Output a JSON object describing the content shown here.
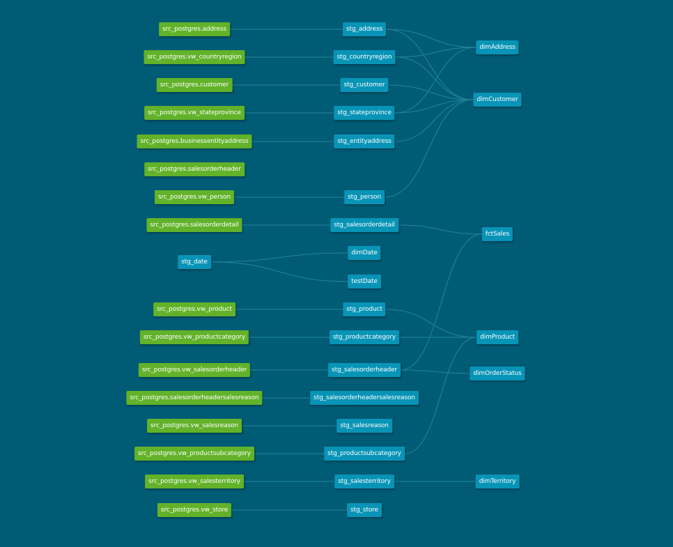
{
  "colors": {
    "background": "#005b75",
    "source_node": "#62b22a",
    "model_node": "#0894b6",
    "edge": "#1e7e92"
  },
  "nodes": [
    {
      "id": "src_address",
      "label": "src_postgres.address",
      "kind": "source"
    },
    {
      "id": "src_countryregion",
      "label": "src_postgres.vw_countryregion",
      "kind": "source"
    },
    {
      "id": "src_customer",
      "label": "src_postgres.customer",
      "kind": "source"
    },
    {
      "id": "src_stateprovince",
      "label": "src_postgres.vw_stateprovince",
      "kind": "source"
    },
    {
      "id": "src_businessentityaddress",
      "label": "src_postgres.businessentityaddress",
      "kind": "source"
    },
    {
      "id": "src_salesorderheader",
      "label": "src_postgres.salesorderheader",
      "kind": "source"
    },
    {
      "id": "src_person",
      "label": "src_postgres.vw_person",
      "kind": "source"
    },
    {
      "id": "src_salesorderdetail",
      "label": "src_postgres.salesorderdetail",
      "kind": "source"
    },
    {
      "id": "stg_date",
      "label": "stg_date",
      "kind": "model"
    },
    {
      "id": "src_product",
      "label": "src_postgres.vw_product",
      "kind": "source"
    },
    {
      "id": "src_productcategory",
      "label": "src_postgres.vw_productcategory",
      "kind": "source"
    },
    {
      "id": "src_vw_salesorderheader",
      "label": "src_postgres.vw_salesorderheader",
      "kind": "source"
    },
    {
      "id": "src_salesorderheadersalesreason",
      "label": "src_postgres.salesorderheadersalesreason",
      "kind": "source"
    },
    {
      "id": "src_salesreason",
      "label": "src_postgres.vw_salesreason",
      "kind": "source"
    },
    {
      "id": "src_productsubcategory",
      "label": "src_postgres.vw_productsubcategory",
      "kind": "source"
    },
    {
      "id": "src_salesterritory",
      "label": "src_postgres.vw_salesterritory",
      "kind": "source"
    },
    {
      "id": "src_store",
      "label": "src_postgres.vw_store",
      "kind": "source"
    },
    {
      "id": "stg_address",
      "label": "stg_address",
      "kind": "model"
    },
    {
      "id": "stg_countryregion",
      "label": "stg_countryregion",
      "kind": "model"
    },
    {
      "id": "stg_customer",
      "label": "stg_customer",
      "kind": "model"
    },
    {
      "id": "stg_stateprovince",
      "label": "stg_stateprovince",
      "kind": "model"
    },
    {
      "id": "stg_entityaddress",
      "label": "stg_entityaddress",
      "kind": "model"
    },
    {
      "id": "stg_person",
      "label": "stg_person",
      "kind": "model"
    },
    {
      "id": "stg_salesorderdetail",
      "label": "stg_salesorderdetail",
      "kind": "model"
    },
    {
      "id": "dimDate",
      "label": "dimDate",
      "kind": "model"
    },
    {
      "id": "testDate",
      "label": "testDate",
      "kind": "model"
    },
    {
      "id": "stg_product",
      "label": "stg_product",
      "kind": "model"
    },
    {
      "id": "stg_productcategory",
      "label": "stg_productcategory",
      "kind": "model"
    },
    {
      "id": "stg_salesorderheader",
      "label": "stg_salesorderheader",
      "kind": "model"
    },
    {
      "id": "stg_salesorderheadersalesreason",
      "label": "stg_salesorderheadersalesreason",
      "kind": "model"
    },
    {
      "id": "stg_salesreason",
      "label": "stg_salesreason",
      "kind": "model"
    },
    {
      "id": "stg_productsubcategory",
      "label": "stg_productsubcategory",
      "kind": "model"
    },
    {
      "id": "stg_salesterritory",
      "label": "stg_salesterritory",
      "kind": "model"
    },
    {
      "id": "stg_store",
      "label": "stg_store",
      "kind": "model"
    },
    {
      "id": "dimAddress",
      "label": "dimAddress",
      "kind": "model"
    },
    {
      "id": "dimCustomer",
      "label": "dimCustomer",
      "kind": "model"
    },
    {
      "id": "fctSales",
      "label": "fctSales",
      "kind": "model"
    },
    {
      "id": "dimProduct",
      "label": "dimProduct",
      "kind": "model"
    },
    {
      "id": "dimOrderStatus",
      "label": "dimOrderStatus",
      "kind": "model"
    },
    {
      "id": "dimTerritory",
      "label": "dimTerritory",
      "kind": "model"
    }
  ],
  "edges": [
    [
      "src_address",
      "stg_address"
    ],
    [
      "src_countryregion",
      "stg_countryregion"
    ],
    [
      "src_customer",
      "stg_customer"
    ],
    [
      "src_stateprovince",
      "stg_stateprovince"
    ],
    [
      "src_businessentityaddress",
      "stg_entityaddress"
    ],
    [
      "src_person",
      "stg_person"
    ],
    [
      "src_salesorderdetail",
      "stg_salesorderdetail"
    ],
    [
      "stg_date",
      "dimDate"
    ],
    [
      "stg_date",
      "testDate"
    ],
    [
      "src_product",
      "stg_product"
    ],
    [
      "src_productcategory",
      "stg_productcategory"
    ],
    [
      "src_vw_salesorderheader",
      "stg_salesorderheader"
    ],
    [
      "src_salesorderheadersalesreason",
      "stg_salesorderheadersalesreason"
    ],
    [
      "src_salesreason",
      "stg_salesreason"
    ],
    [
      "src_productsubcategory",
      "stg_productsubcategory"
    ],
    [
      "src_salesterritory",
      "stg_salesterritory"
    ],
    [
      "src_store",
      "stg_store"
    ],
    [
      "stg_address",
      "dimAddress"
    ],
    [
      "stg_countryregion",
      "dimAddress"
    ],
    [
      "stg_stateprovince",
      "dimAddress"
    ],
    [
      "stg_address",
      "dimCustomer"
    ],
    [
      "stg_countryregion",
      "dimCustomer"
    ],
    [
      "stg_customer",
      "dimCustomer"
    ],
    [
      "stg_stateprovince",
      "dimCustomer"
    ],
    [
      "stg_entityaddress",
      "dimCustomer"
    ],
    [
      "stg_person",
      "dimCustomer"
    ],
    [
      "stg_salesorderdetail",
      "fctSales"
    ],
    [
      "stg_salesorderheader",
      "fctSales"
    ],
    [
      "stg_product",
      "dimProduct"
    ],
    [
      "stg_productcategory",
      "dimProduct"
    ],
    [
      "stg_productsubcategory",
      "dimProduct"
    ],
    [
      "stg_salesorderheader",
      "dimOrderStatus"
    ],
    [
      "stg_salesterritory",
      "dimTerritory"
    ]
  ]
}
